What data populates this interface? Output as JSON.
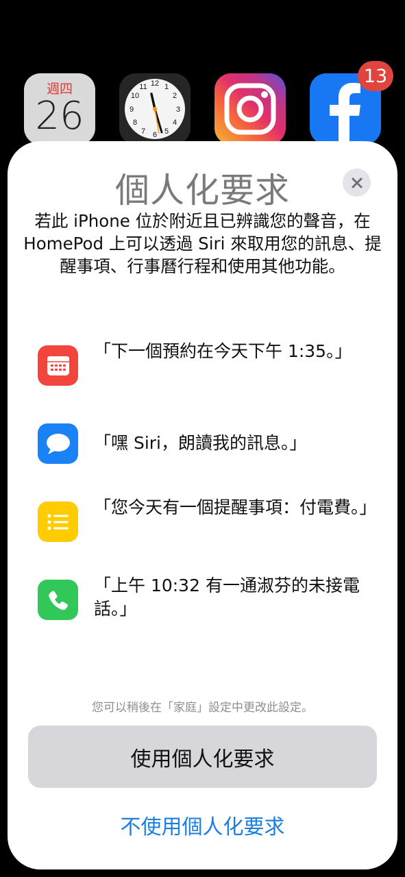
{
  "homescreen": {
    "calendar_weekday": "週四",
    "calendar_day": "26",
    "clock_numbers": [
      "12",
      "1",
      "2",
      "3",
      "4",
      "5",
      "6",
      "7",
      "8",
      "9",
      "10",
      "11"
    ],
    "facebook_badge": "13"
  },
  "sheet": {
    "title": "個人化要求",
    "description": "若此 iPhone 位於附近且已辨識您的聲音，在 HomePod 上可以透過 Siri 來取用您的訊息、提醒事項、行事曆行程和使用其他功能。",
    "examples": [
      {
        "icon": "calendar-icon",
        "color": "#f2453d",
        "text": "「下一個預約在今天下午 1:35。」"
      },
      {
        "icon": "messages-icon",
        "color": "#1a82f7",
        "text": "「嘿 Siri，朗讀我的訊息。」"
      },
      {
        "icon": "reminders-icon",
        "color": "#ffcc00",
        "text": "「您今天有一個提醒事項：付電費。」"
      },
      {
        "icon": "phone-icon",
        "color": "#32c759",
        "text": "「上午 10:32 有一通淑芬的未接電話。」"
      }
    ],
    "footnote": "您可以稍後在「家庭」設定中更改此設定。",
    "primary_button": "使用個人化要求",
    "secondary_button": "不使用個人化要求"
  }
}
